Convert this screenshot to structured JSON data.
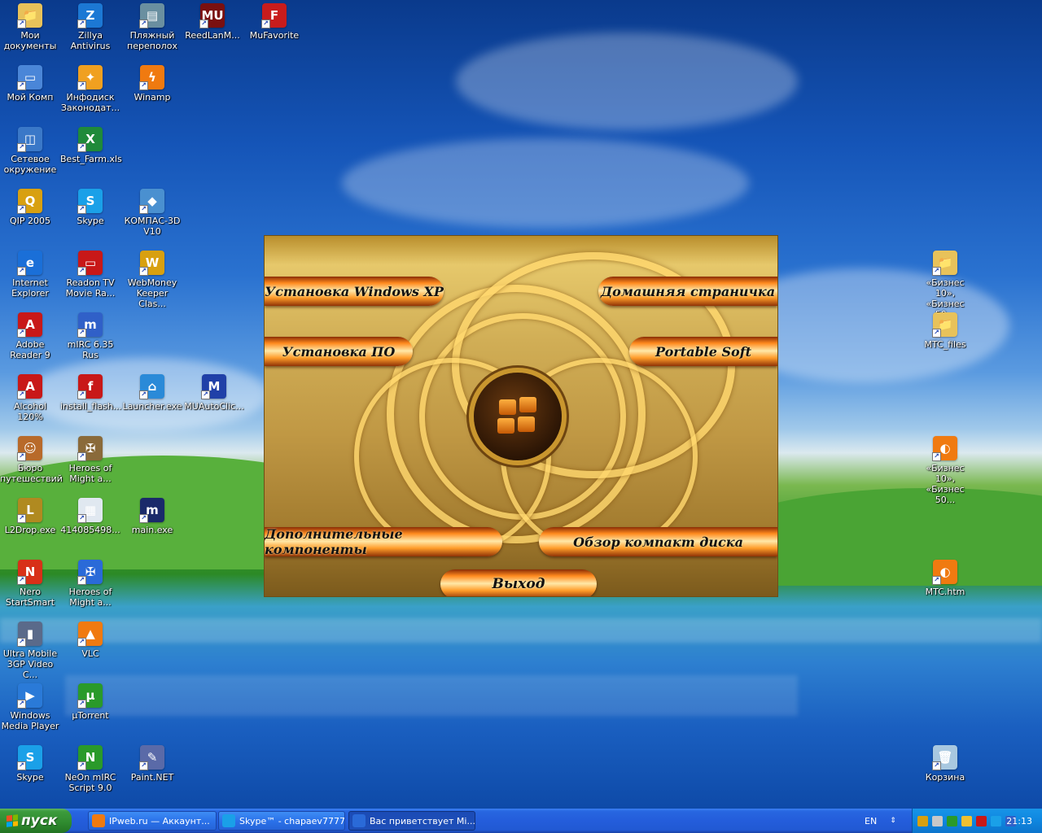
{
  "desktop": {
    "icons": [
      {
        "label": "Мои документы",
        "color": "#e8c25a",
        "glyph": "📁"
      },
      {
        "label": "Zillya Antivirus",
        "color": "#1c78d4",
        "glyph": "Z"
      },
      {
        "label": "Пляжный переполох",
        "color": "#6a8fa0",
        "glyph": "▤"
      },
      {
        "label": "ReedLanM...",
        "color": "#7a1010",
        "glyph": "MU"
      },
      {
        "label": "MuFavorite",
        "color": "#c81c1c",
        "glyph": "F"
      },
      {
        "label": "Мой Комп",
        "color": "#4a86d8",
        "glyph": "▭"
      },
      {
        "label": "Инфодиск Законодат...",
        "color": "#f0a020",
        "glyph": "✦"
      },
      {
        "label": "Winamp",
        "color": "#f07a10",
        "glyph": "ϟ"
      },
      {
        "label": "Сетевое окружение",
        "color": "#3a78c8",
        "glyph": "◫"
      },
      {
        "label": "Best_Farm.xls",
        "color": "#1f8a3a",
        "glyph": "X"
      },
      {
        "label": "QIP 2005",
        "color": "#d8a010",
        "glyph": "Q"
      },
      {
        "label": "Skype",
        "color": "#1aa0e8",
        "glyph": "S"
      },
      {
        "label": "КОМПАС-3D V10",
        "color": "#4a90d0",
        "glyph": "◆"
      },
      {
        "label": "Internet Explorer",
        "color": "#1a6fd8",
        "glyph": "e"
      },
      {
        "label": "Readon TV Movie Ra...",
        "color": "#c81818",
        "glyph": "▭"
      },
      {
        "label": "WebMoney Keeper Clas...",
        "color": "#d8a010",
        "glyph": "W"
      },
      {
        "label": "Adobe Reader 9",
        "color": "#c81818",
        "glyph": "A"
      },
      {
        "label": "mIRC 6.35 Rus",
        "color": "#3060c8",
        "glyph": "m"
      },
      {
        "label": "Alcohol 120%",
        "color": "#c81818",
        "glyph": "A"
      },
      {
        "label": "install_flash...",
        "color": "#c81818",
        "glyph": "f"
      },
      {
        "label": "Launcher.exe",
        "color": "#2a8ad8",
        "glyph": "⌂"
      },
      {
        "label": "MUAutoClic...",
        "color": "#2040a8",
        "glyph": "M"
      },
      {
        "label": "Бюро путешествий",
        "color": "#b86a2a",
        "glyph": "☺"
      },
      {
        "label": "Heroes of Might a...",
        "color": "#8a6a3a",
        "glyph": "✠"
      },
      {
        "label": "L2Drop.exe",
        "color": "#b08a20",
        "glyph": "L"
      },
      {
        "label": "414085498...",
        "color": "#e0e8f0",
        "glyph": "▦"
      },
      {
        "label": "main.exe",
        "color": "#1a2a6a",
        "glyph": "m"
      },
      {
        "label": "Nero StartSmart",
        "color": "#d83018",
        "glyph": "N"
      },
      {
        "label": "Heroes of Might a...",
        "color": "#2a6ad8",
        "glyph": "✠"
      },
      {
        "label": "Ultra Mobile 3GP Video C...",
        "color": "#5a6a8a",
        "glyph": "▮"
      },
      {
        "label": "VLC",
        "color": "#f07a10",
        "glyph": "▲"
      },
      {
        "label": "Windows Media Player",
        "color": "#2a7ad8",
        "glyph": "▶"
      },
      {
        "label": "µTorrent",
        "color": "#2a9a2a",
        "glyph": "µ"
      },
      {
        "label": "Skype",
        "color": "#1aa0e8",
        "glyph": "S"
      },
      {
        "label": "NeOn mIRC Script 9.0",
        "color": "#2a9a2a",
        "glyph": "N"
      },
      {
        "label": "Paint.NET",
        "color": "#5a6aa8",
        "glyph": "✎"
      },
      {
        "label": "«Бизнес 10», «Бизнес 50...",
        "color": "#e8c25a",
        "glyph": "📁"
      },
      {
        "label": "MTC_files",
        "color": "#e8c25a",
        "glyph": "📁"
      },
      {
        "label": "«Бизнес 10», «Бизнес 50...",
        "color": "#f07a10",
        "glyph": "◐"
      },
      {
        "label": "MTC.htm",
        "color": "#f07a10",
        "glyph": "◐"
      },
      {
        "label": "Корзина",
        "color": "#a8c8e0",
        "glyph": "🗑"
      }
    ]
  },
  "autorun": {
    "buttons": {
      "install_xp": "Установка Windows XP",
      "homepage": "Домашняя страничка",
      "install_soft": "Установка ПО",
      "portable": "Portable Soft",
      "extra": "Дополнительные компоненты",
      "browse_cd": "Обзор компакт диска",
      "exit": "Выход"
    }
  },
  "taskbar": {
    "start_label": "пуск",
    "tasks": [
      {
        "label": "IPweb.ru — Аккаунт...",
        "color": "#f07a10"
      },
      {
        "label": "Skype™ - chapaev7777",
        "color": "#1aa0e8"
      },
      {
        "label": "Вас приветствует Mi...",
        "color": "#2a6ad8"
      }
    ],
    "language": "EN",
    "clock": "21:13",
    "tray_icons": [
      "#d8a010",
      "#c8c8c8",
      "#2a9a2a",
      "#f0c030",
      "#c81818",
      "#1aa0e8",
      "#3060c8"
    ]
  }
}
